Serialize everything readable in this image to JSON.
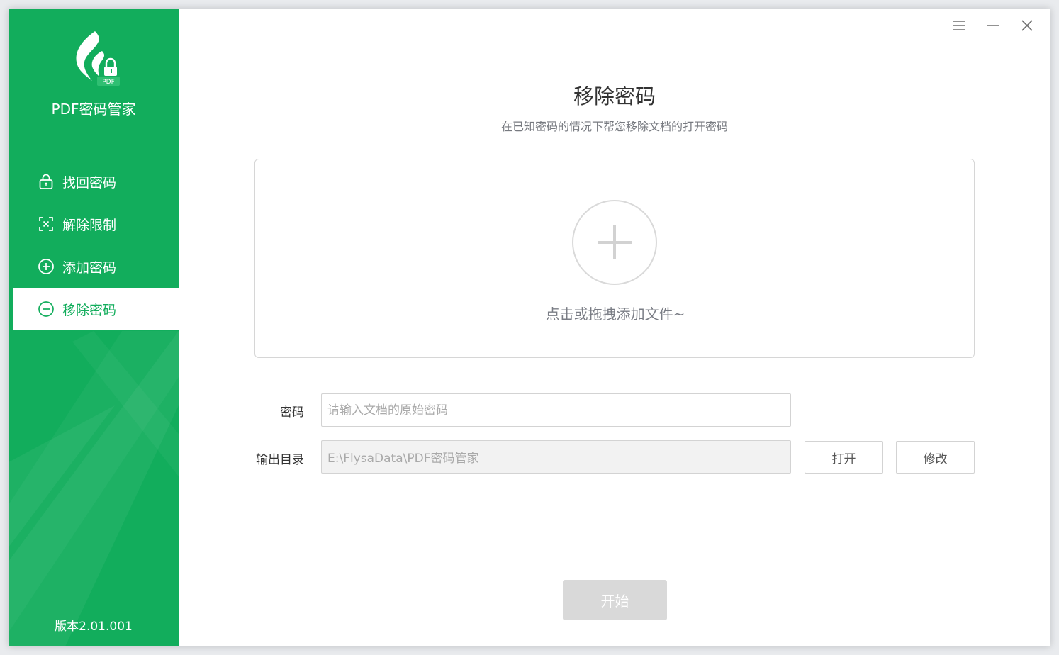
{
  "app": {
    "title": "PDF密码管家",
    "version": "版本2.01.001",
    "logo_badge": "PDF"
  },
  "colors": {
    "brand": "#12ad5c",
    "disabled": "#d9d9d9"
  },
  "window_controls": {
    "menu_icon": "menu-icon",
    "minimize_icon": "minimize-icon",
    "close_icon": "close-icon"
  },
  "sidebar": {
    "items": [
      {
        "label": "找回密码",
        "icon": "lock-icon",
        "active": false
      },
      {
        "label": "解除限制",
        "icon": "unrestrict-icon",
        "active": false
      },
      {
        "label": "添加密码",
        "icon": "plus-circle-icon",
        "active": false
      },
      {
        "label": "移除密码",
        "icon": "minus-circle-icon",
        "active": true
      }
    ]
  },
  "main": {
    "title": "移除密码",
    "subtitle": "在已知密码的情况下帮您移除文档的打开密码",
    "dropzone_hint": "点击或拖拽添加文件~",
    "password": {
      "label": "密码",
      "placeholder": "请输入文档的原始密码",
      "value": ""
    },
    "output": {
      "label": "输出目录",
      "value": "E:\\FlysaData\\PDF密码管家"
    },
    "open_button": "打开",
    "modify_button": "修改",
    "start_button": "开始"
  }
}
